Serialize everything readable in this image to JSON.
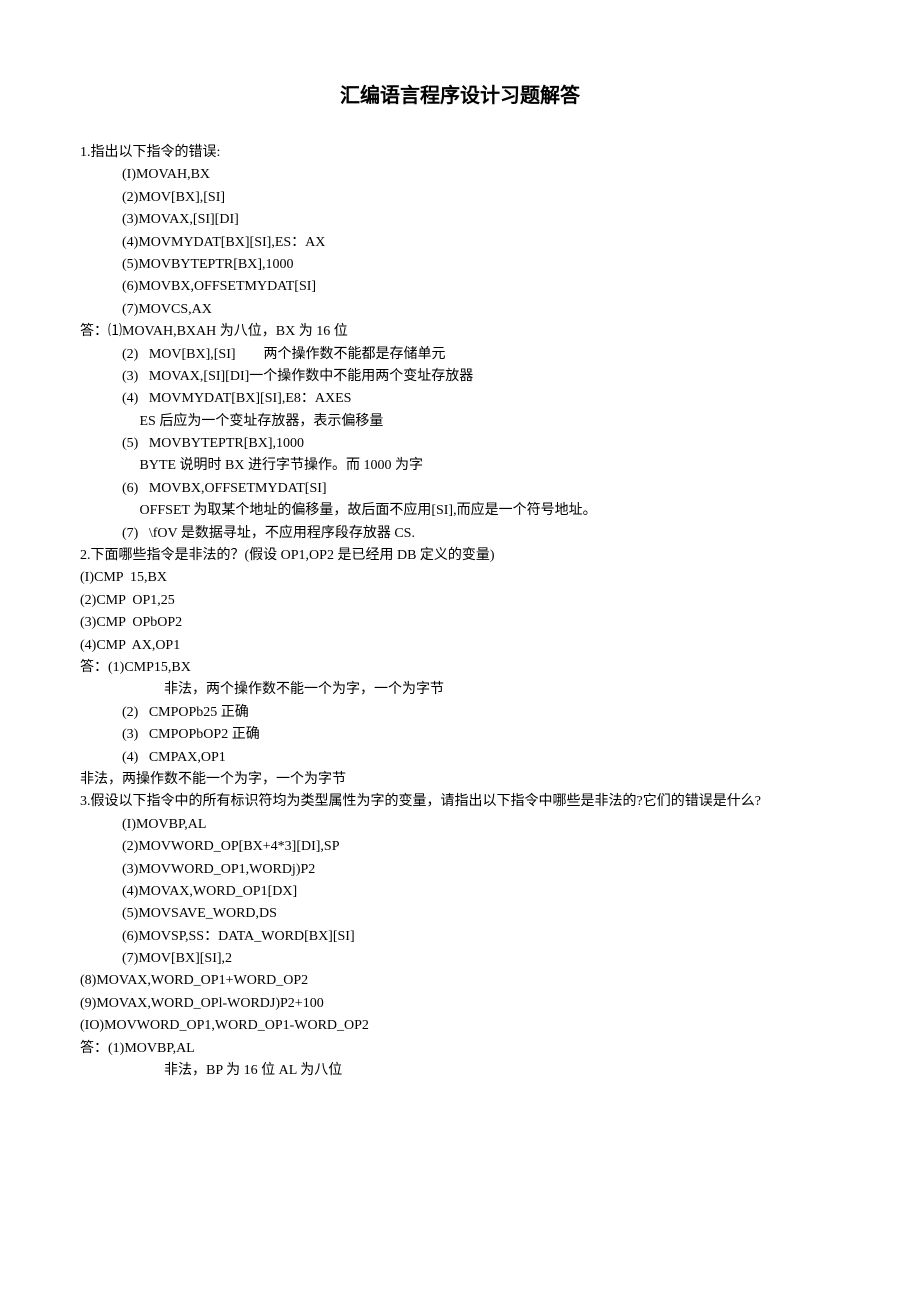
{
  "title": "汇编语言程序设计习题解答",
  "q1": {
    "header": "1.指出以下指令的错误:",
    "items": [
      "(I)MOVAH,BX",
      "(2)MOV[BX],[SI]",
      "(3)MOVAX,[SI][DI]",
      "(4)MOVMYDAT[BX][SI],ES：AX",
      "(5)MOVBYTEPTR[BX],1000",
      "(6)MOVBX,OFFSETMYDAT[SI]",
      "(7)MOVCS,AX"
    ],
    "answer_header": "答：⑴MOVAH,BXAH 为八位，BX 为 16 位",
    "answers": [
      "(2)   MOV[BX],[SI]        两个操作数不能都是存储单元",
      "(3)   MOVAX,[SI][DI]一个操作数中不能用两个变址存放器",
      "(4)   MOVMYDAT[BX][SI],E8：AXES",
      "     ES 后应为一个变址存放器，表示偏移量",
      "(5)   MOVBYTEPTR[BX],1000",
      "     BYTE 说明时 BX 进行字节操作。而 1000 为字",
      "(6)   MOVBX,OFFSETMYDAT[SI]",
      "     OFFSET 为取某个地址的偏移量，故后面不应用[SI],而应是一个符号地址。",
      "(7)   \\fOV 是数据寻址，不应用程序段存放器 CS."
    ]
  },
  "q2": {
    "header": "2.下面哪些指令是非法的？(假设 OP1,OP2 是已经用 DB 定义的变量)",
    "items": [
      "(I)CMP  15,BX",
      "(2)CMP  OP1,25",
      "(3)CMP  OPbOP2",
      "(4)CMP  AX,OP1"
    ],
    "answer_header": "答：(1)CMP15,BX",
    "answer_indent": "非法，两个操作数不能一个为字，一个为字节",
    "answers": [
      "(2)   CMPOPb25 正确",
      "(3)   CMPOPbOP2 正确",
      "(4)   CMPAX,OP1"
    ],
    "footer": "非法，两操作数不能一个为字，一个为字节"
  },
  "q3": {
    "header": "3.假设以下指令中的所有标识符均为类型属性为字的变量，请指出以下指令中哪些是非法的?它们的错误是什么?",
    "items": [
      "(I)MOVBP,AL",
      "(2)MOVWORD_OP[BX+4*3][DI],SP",
      "(3)MOVWORD_OP1,WORDj)P2",
      "(4)MOVAX,WORD_OP1[DX]",
      "(5)MOVSAVE_WORD,DS",
      "(6)MOVSP,SS：DATA_WORD[BX][SI]",
      "(7)MOV[BX][SI],2"
    ],
    "items_noindent": [
      "(8)MOVAX,WORD_OP1+WORD_OP2",
      "(9)MOVAX,WORD_OPl-WORDJ)P2+100",
      "(IO)MOVWORD_OP1,WORD_OP1-WORD_OP2"
    ],
    "answer_header": "答：(1)MOVBP,AL",
    "answer_indent": "非法，BP 为 16 位 AL 为八位"
  }
}
